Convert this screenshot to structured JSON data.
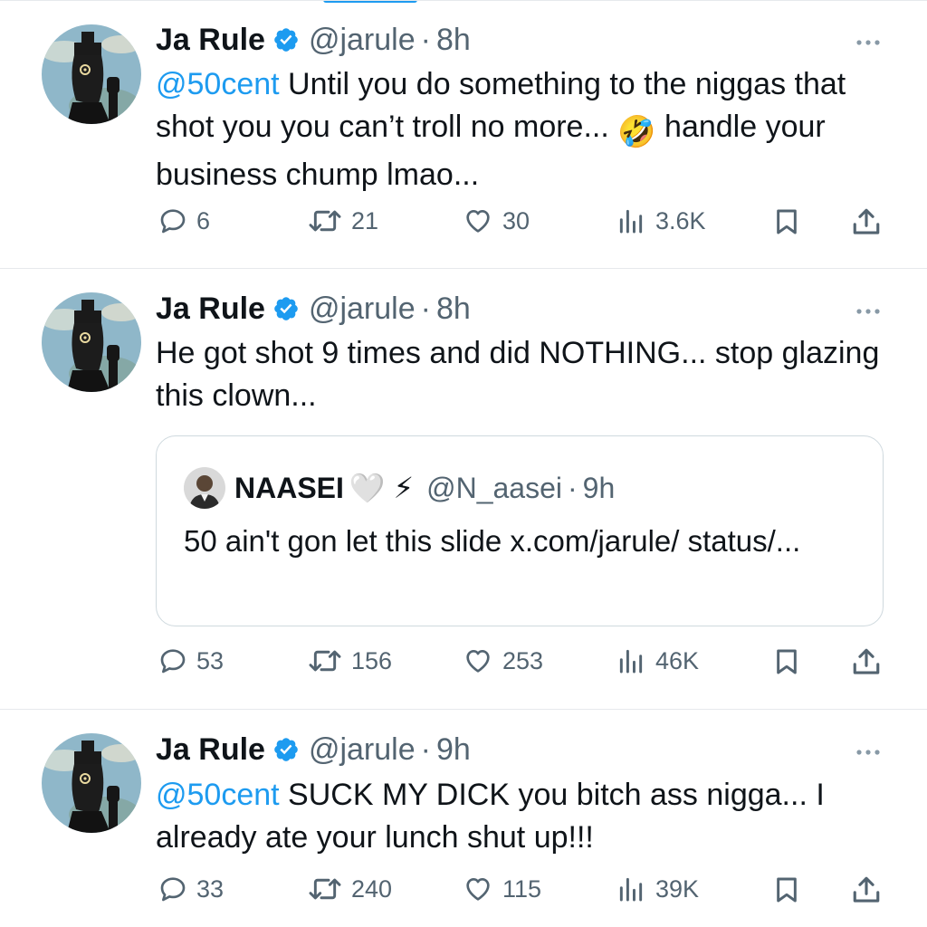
{
  "tweets": [
    {
      "author": "Ja Rule",
      "handle": "@jarule",
      "time": "8h",
      "mention": "@50cent",
      "text_part1": " Until you do something to the niggas that shot you you can’t troll no more... ",
      "text_emoji": "🤣",
      "text_part2": " handle your business chump lmao...",
      "replies": "6",
      "reposts": "21",
      "likes": "30",
      "views": "3.6K"
    },
    {
      "author": "Ja Rule",
      "handle": "@jarule",
      "time": "8h",
      "text": "He got shot 9 times and did NOTHING... stop glazing this clown...",
      "quote": {
        "author": "NAASEI",
        "author_emojis": "🤍 ⚡",
        "handle": "@N_aasei",
        "time": "9h",
        "text": "50 ain't gon let this slide x.com/jarule/ status/..."
      },
      "replies": "53",
      "reposts": "156",
      "likes": "253",
      "views": "46K"
    },
    {
      "author": "Ja Rule",
      "handle": "@jarule",
      "time": "9h",
      "mention": "@50cent",
      "text": " SUCK MY DICK you bitch ass nigga... I already ate your lunch shut up!!!",
      "replies": "33",
      "reposts": "240",
      "likes": "115",
      "views": "39K"
    }
  ],
  "colors": {
    "accent": "#1d9bf0",
    "text": "#0f1419",
    "secondary": "#536471",
    "divider": "#e6e9ec"
  },
  "icons": [
    "verified-badge-icon",
    "more-icon",
    "reply-icon",
    "repost-icon",
    "like-icon",
    "views-icon",
    "bookmark-icon",
    "share-icon"
  ]
}
